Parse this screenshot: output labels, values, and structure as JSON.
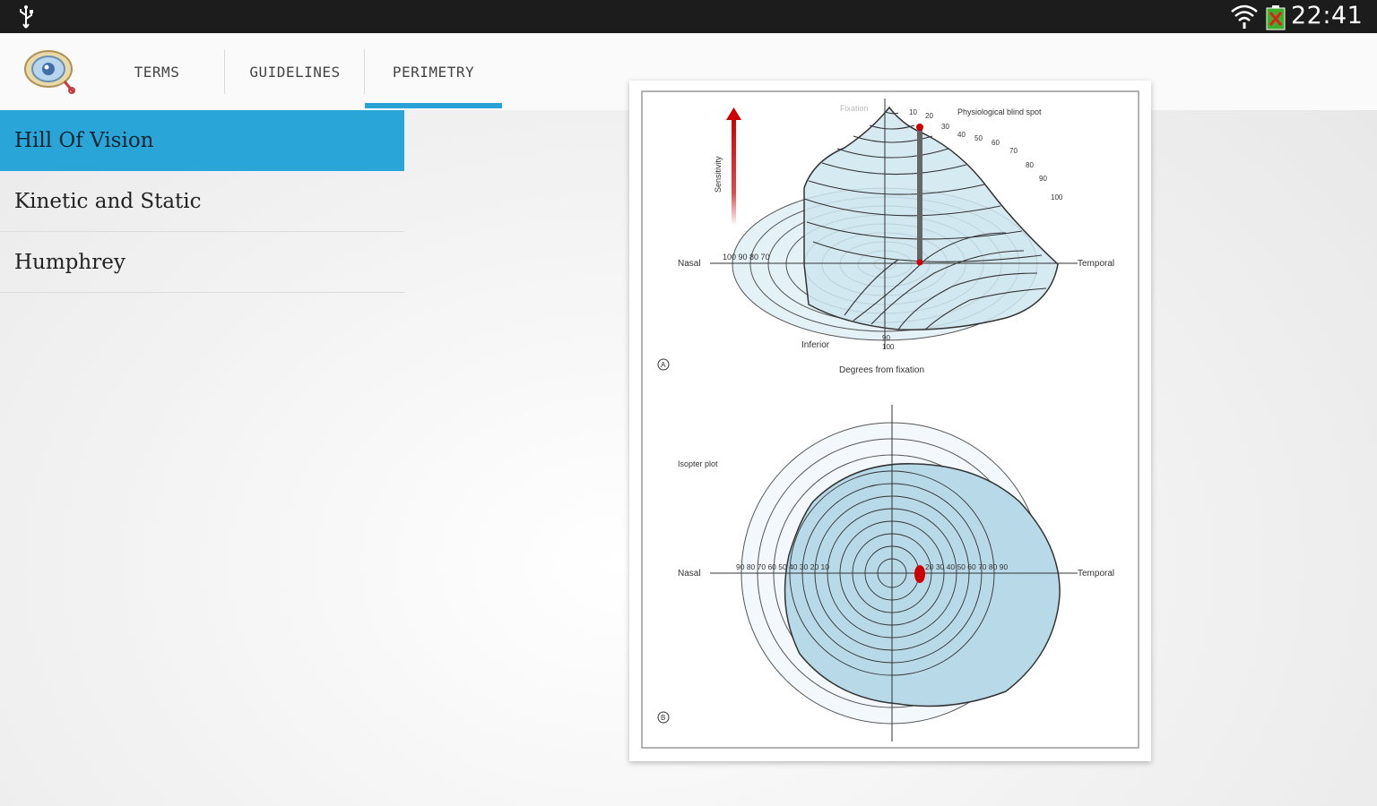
{
  "status_bar": {
    "time": "22:41",
    "icons": [
      "usb-icon",
      "wifi-icon",
      "battery-charging-icon"
    ]
  },
  "tabs": [
    {
      "label": "TERMS"
    },
    {
      "label": "GUIDELINES"
    },
    {
      "label": "PERIMETRY",
      "selected": true
    }
  ],
  "sidebar": {
    "items": [
      {
        "label": "Hill Of Vision",
        "selected": true
      },
      {
        "label": "Kinetic and Static"
      },
      {
        "label": "Humphrey"
      }
    ]
  },
  "figure": {
    "panel_a": {
      "fixation": "Fixation",
      "blind_spot": "Physiological blind spot",
      "sensitivity": "Sensitivity",
      "nasal": "Nasal",
      "temporal": "Temporal",
      "inferior": "Inferior",
      "degrees_label": "Degrees from fixation",
      "nasal_ticks": "100 90 80 70",
      "bottom_ticks": [
        "90",
        "100"
      ],
      "temporal_ticks": [
        "10",
        "20",
        "30",
        "40",
        "50",
        "60",
        "70",
        "80",
        "90",
        "100"
      ],
      "panel_label": "A"
    },
    "panel_b": {
      "isopter_plot": "Isopter plot",
      "nasal": "Nasal",
      "temporal": "Temporal",
      "nasal_ticks": "90 80 70 60 50 40 30 20 10",
      "temporal_ticks": "20 30 40 50 60 70 80 90",
      "panel_label": "B"
    },
    "colors": {
      "fill": "#cfe6ef",
      "fill_dark": "#a9d2e3",
      "marker": "#cc0000"
    }
  },
  "colors": {
    "accent": "#2aa5d8",
    "status_bar": "#1c1c1c",
    "action_bar": "#fafafa"
  }
}
